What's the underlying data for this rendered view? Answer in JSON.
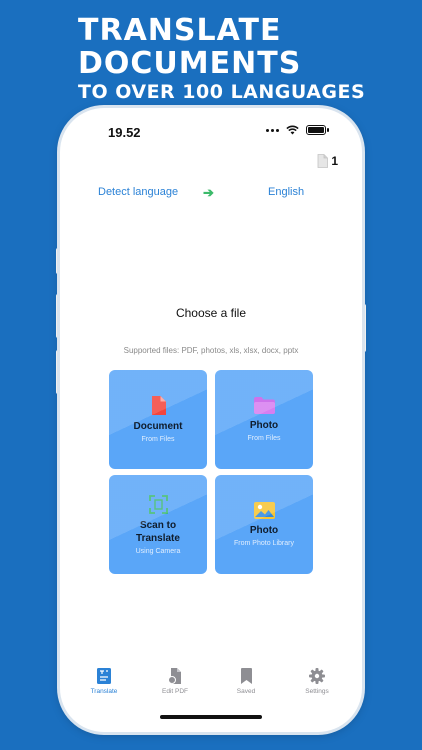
{
  "headline": {
    "line1": "TRANSLATE",
    "line2": "DOCUMENTS",
    "line3": "TO OVER 100 LANGUAGES"
  },
  "status_bar": {
    "time": "19.52",
    "icons": [
      "signal-dots-icon",
      "wifi-icon",
      "battery-icon"
    ]
  },
  "header": {
    "doc_count": "1",
    "doc_icon": "document-icon"
  },
  "language": {
    "source": "Detect language",
    "target": "English",
    "arrow": "➔"
  },
  "main": {
    "title": "Choose a file",
    "supported": "Supported files: PDF, photos, xls, xlsx, docx, pptx",
    "tiles": [
      {
        "label": "Document",
        "sub": "From Files",
        "icon": "document-icon",
        "icon_color": "#f2453d"
      },
      {
        "label": "Photo",
        "sub": "From Files",
        "icon": "folder-icon",
        "icon_color": "#c65ce8"
      },
      {
        "label": "Scan to Translate",
        "sub": "Using Camera",
        "icon": "scan-icon",
        "icon_color": "#3cba6a"
      },
      {
        "label": "Photo",
        "sub": "From Photo Library",
        "icon": "photo-icon",
        "icon_color": "#f6c432"
      }
    ]
  },
  "tabbar": {
    "items": [
      {
        "label": "Translate",
        "icon": "translate-icon",
        "active": true
      },
      {
        "label": "Edit PDF",
        "icon": "edit-pdf-icon",
        "active": false
      },
      {
        "label": "Saved",
        "icon": "bookmark-icon",
        "active": false
      },
      {
        "label": "Settings",
        "icon": "gear-icon",
        "active": false
      }
    ]
  },
  "colors": {
    "background": "#1a6fbf",
    "accent": "#2b82d6",
    "tile": "#5aa6f8",
    "arrow": "#3cba6a"
  }
}
